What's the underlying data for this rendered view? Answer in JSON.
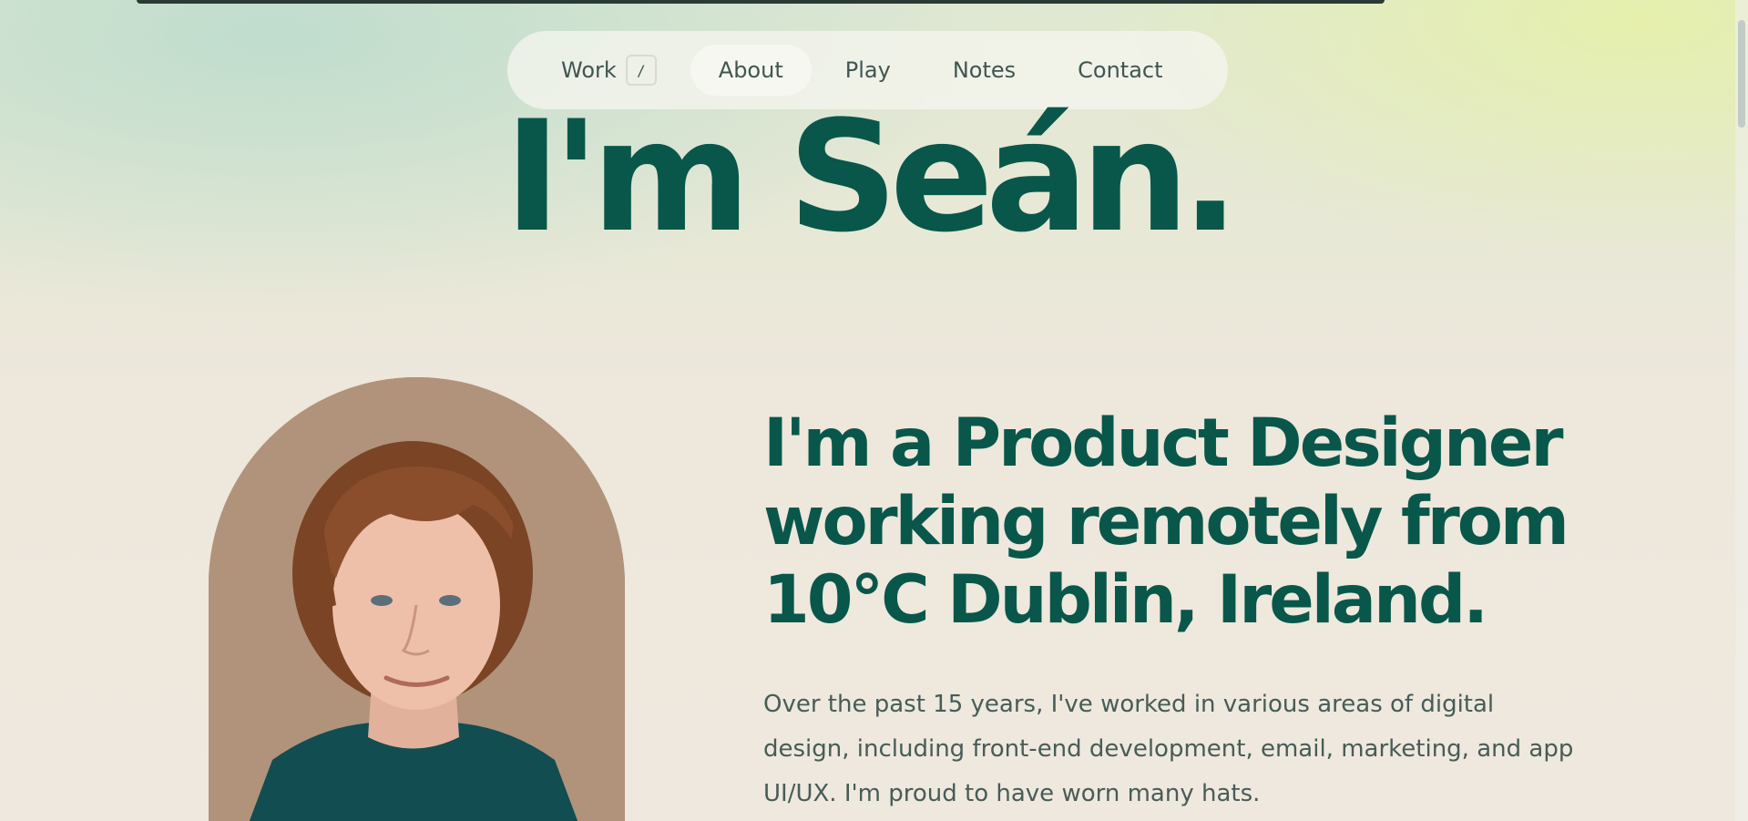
{
  "nav": {
    "items": [
      {
        "label": "Work",
        "shortcut": "/"
      },
      {
        "label": "About"
      },
      {
        "label": "Play"
      },
      {
        "label": "Notes"
      },
      {
        "label": "Contact"
      }
    ],
    "active": "About"
  },
  "hero": {
    "title": "I'm Seán."
  },
  "about": {
    "headline_line1": "I'm a Product Designer",
    "headline_line2": "working remotely from",
    "headline_line3": "10°C Dublin, Ireland.",
    "bio": "Over the past 15 years, I've worked in various areas of digital design, including front-end development, email, marketing, and app UI/UX. I'm proud to have worn many hats."
  },
  "colors": {
    "brand_green": "#08574a",
    "body_text": "#475c57",
    "portrait_bg": "#b0937a"
  }
}
